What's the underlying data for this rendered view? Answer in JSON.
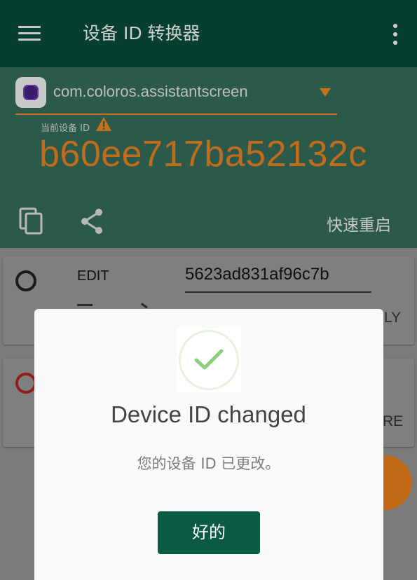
{
  "appbar": {
    "title": "设备 ID 转换器"
  },
  "header": {
    "package_name": "com.coloros.assistantscreen",
    "current_id_label": "当前设备 ID",
    "device_id": "b60ee717ba52132c",
    "restart_label": "快速重启"
  },
  "cards": [
    {
      "edit_label": "EDIT",
      "edit_value": "5623ad831af96c7b",
      "right_text": "LY"
    },
    {
      "right_text": "RE"
    }
  ],
  "dialog": {
    "title": "Device ID changed",
    "message": "您的设备 ID 已更改。",
    "ok_label": "好的"
  },
  "colors": {
    "appbar": "#063f30",
    "header": "#2b5a4b",
    "accent": "#c06c1c",
    "button": "#0a5a44",
    "success": "#8bd17c"
  }
}
